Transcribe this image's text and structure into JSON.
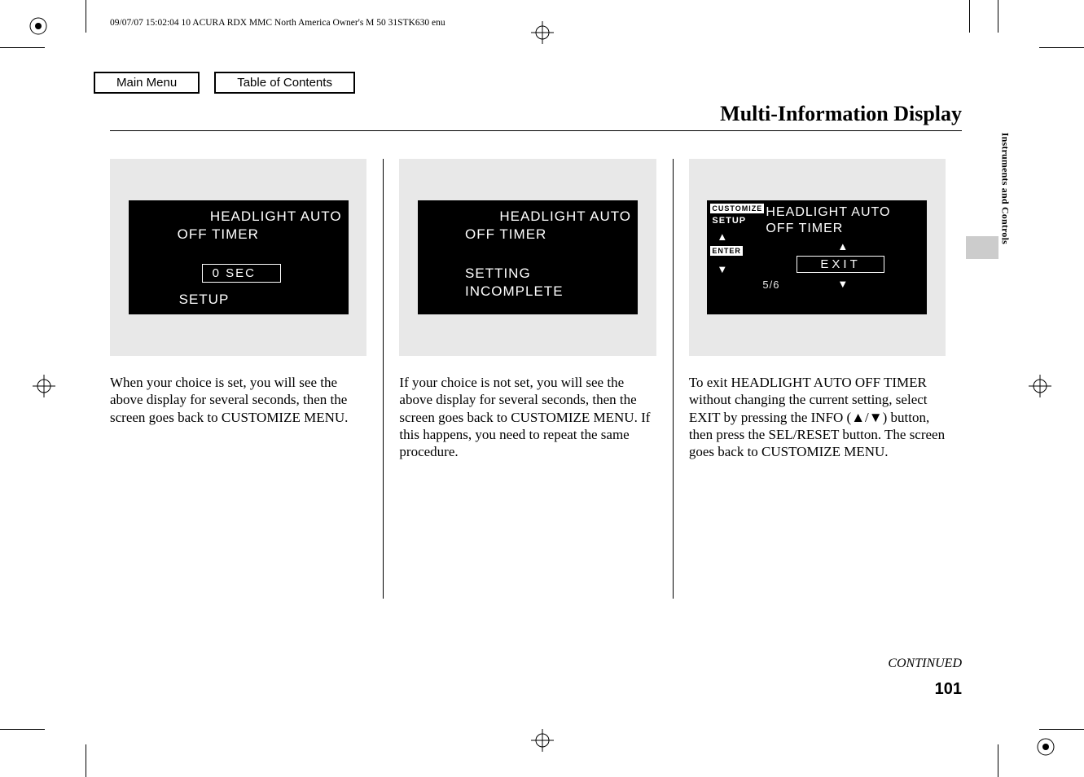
{
  "meta": {
    "header_line": "09/07/07 15:02:04    10 ACURA RDX MMC North America Owner's M 50 31STK630 enu"
  },
  "nav": {
    "main_menu": "Main Menu",
    "toc": "Table of Contents"
  },
  "page": {
    "title": "Multi-Information Display",
    "side_tab": "Instruments and Controls",
    "continued": "CONTINUED",
    "number": "101"
  },
  "col1": {
    "lcd_line1": "HEADLIGHT AUTO",
    "lcd_line2": "OFF TIMER",
    "lcd_box": "0 SEC",
    "lcd_line3": "SETUP",
    "body": "When your choice is set, you will see the above display for several seconds, then the screen goes back to CUSTOMIZE MENU."
  },
  "col2": {
    "lcd_line1": "HEADLIGHT AUTO",
    "lcd_line2": "OFF TIMER",
    "lcd_line3": "SETTING",
    "lcd_line4": "INCOMPLETE",
    "body": "If your choice is not set, you will see the above display for several seconds, then the screen goes back to CUSTOMIZE MENU. If this happens, you need to repeat the same procedure."
  },
  "col3": {
    "lcd_side_top": "CUSTOMIZE",
    "lcd_side_mid": "SETUP",
    "lcd_enter": "ENTER",
    "lcd_line1": "HEADLIGHT AUTO",
    "lcd_line2": "OFF TIMER",
    "lcd_exit": "EXIT",
    "lcd_fraction": "5/6",
    "body": "To exit HEADLIGHT AUTO OFF TIMER without changing the current setting, select EXIT by pressing the INFO (▲/▼) button, then press the SEL/RESET button. The screen goes back to CUSTOMIZE MENU."
  }
}
